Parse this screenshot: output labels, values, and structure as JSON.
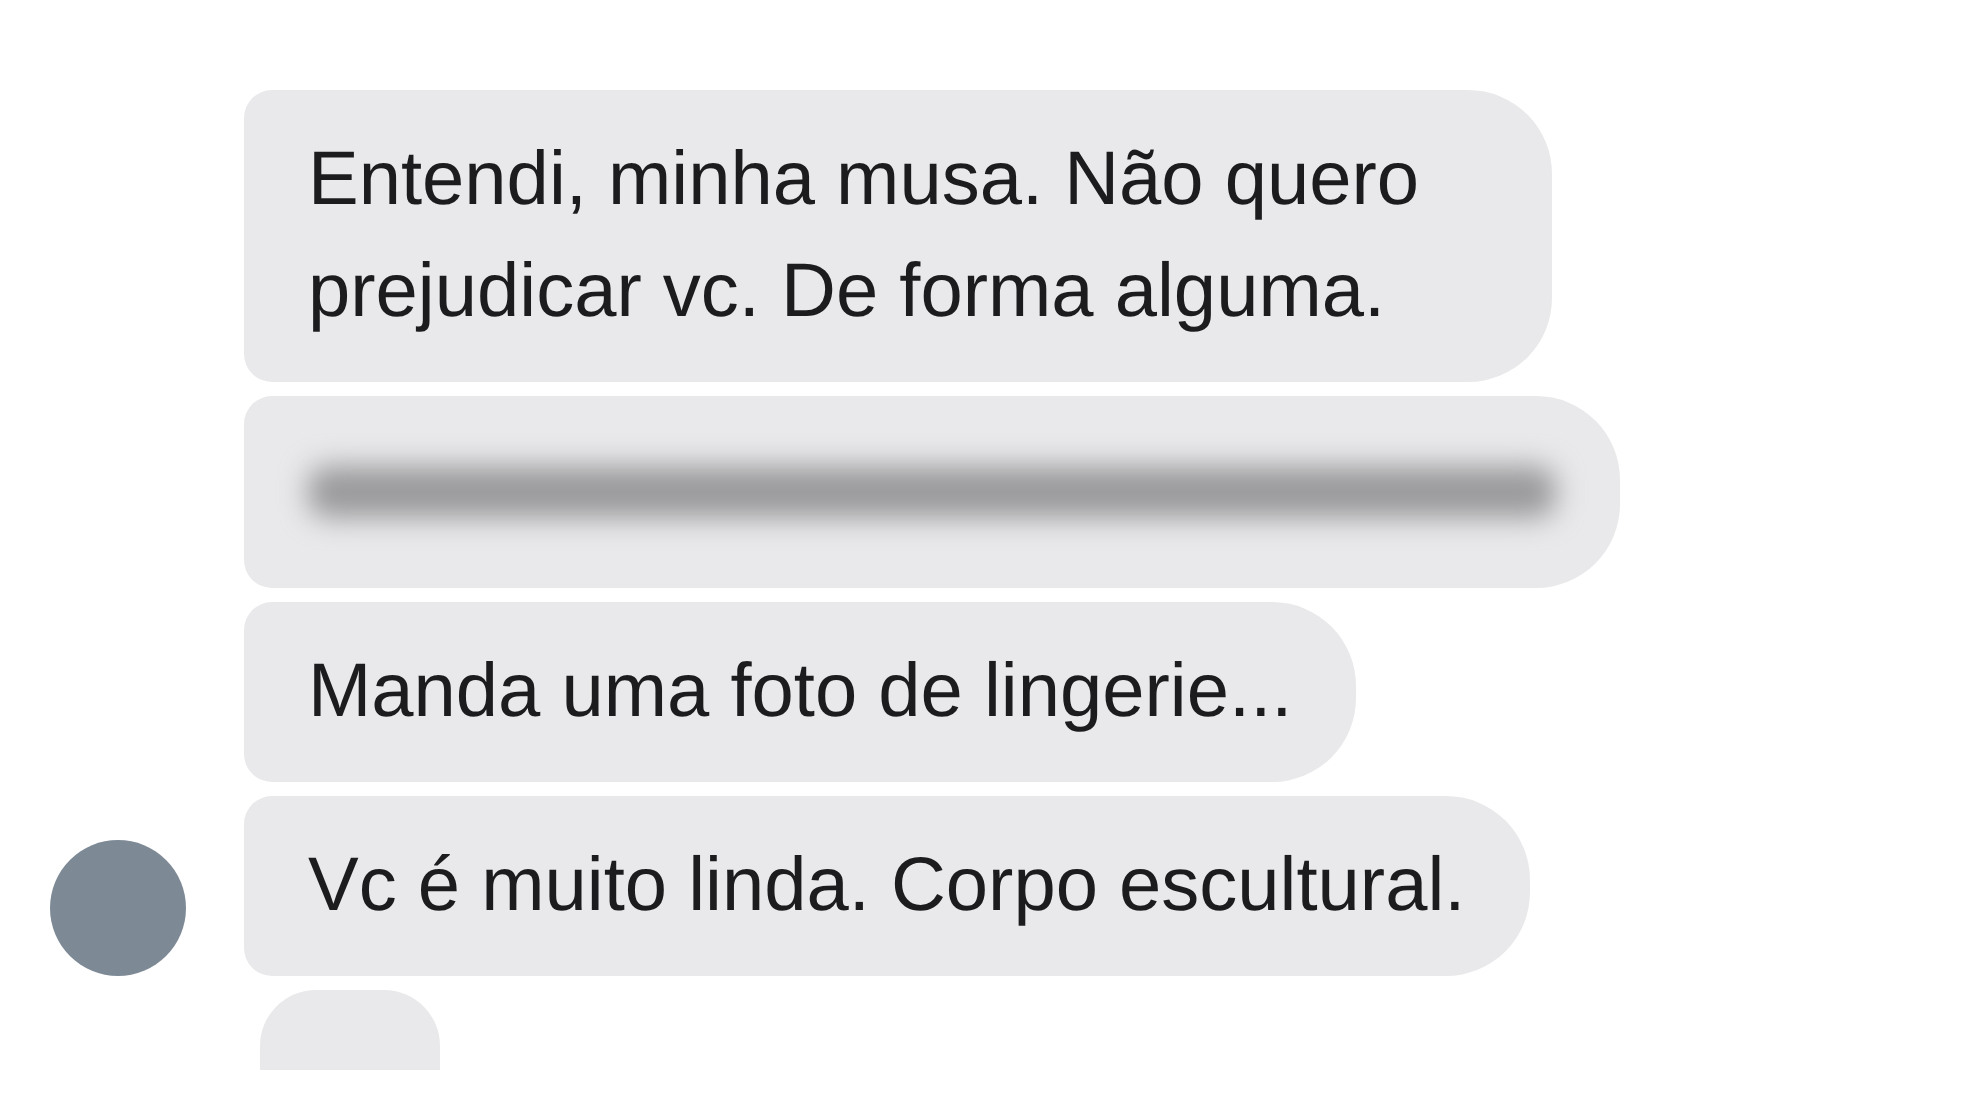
{
  "messages": [
    {
      "kind": "text",
      "text": "Entendi, minha musa. Não quero prejudicar vc. De forma alguma.",
      "avatar": false
    },
    {
      "kind": "blurred",
      "avatar": false
    },
    {
      "kind": "text",
      "text": "Manda uma foto de lingerie...",
      "avatar": false
    },
    {
      "kind": "text",
      "text": "Vc é muito linda. Corpo escultural.",
      "avatar": true
    },
    {
      "kind": "partial",
      "avatar": false
    }
  ]
}
